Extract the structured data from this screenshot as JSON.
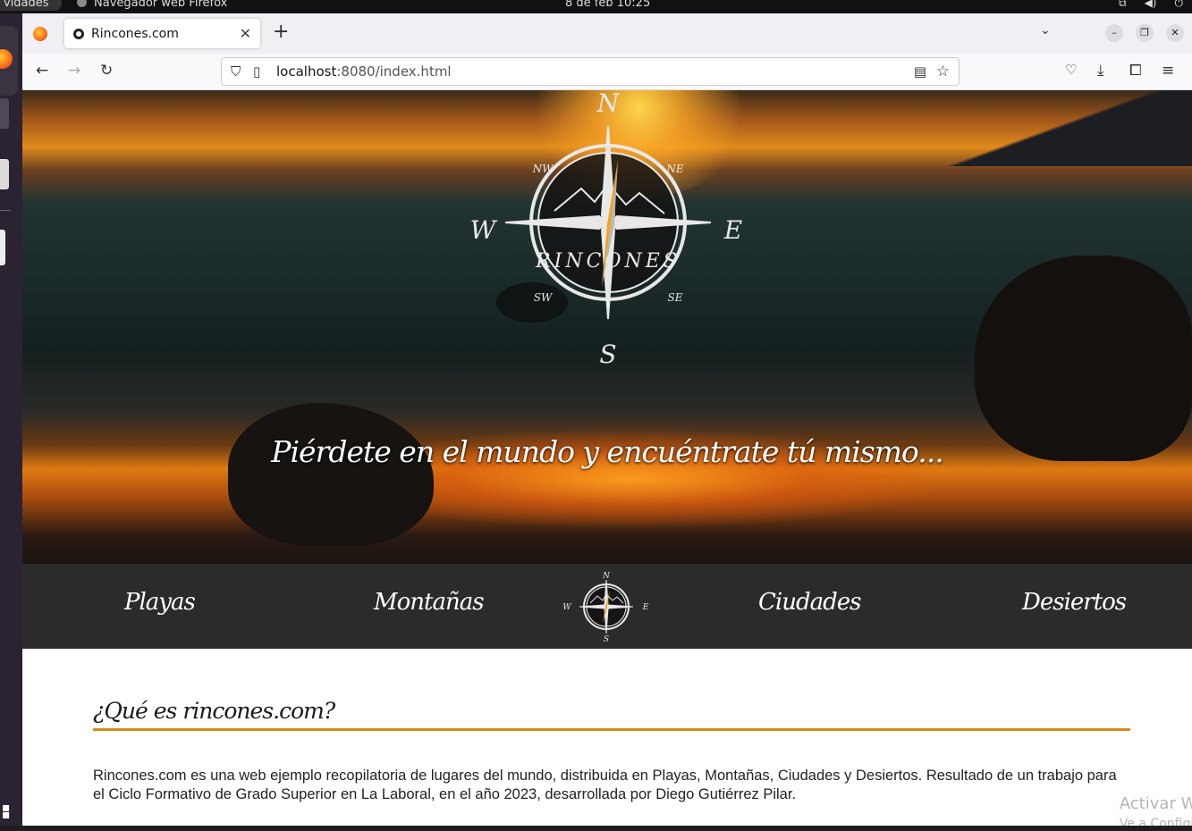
{
  "os": {
    "activities_label": "vidades",
    "app_label": "Navegador web Firefox",
    "clock": "8 de feb  10:25"
  },
  "browser": {
    "tab_title": "Rincones.com",
    "url_host": "localhost",
    "url_rest": ":8080/index.html"
  },
  "hero": {
    "slogan": "Piérdete en el mundo y encuéntrate tú mismo...",
    "compass": {
      "north": "N",
      "south": "S",
      "east": "E",
      "west": "W",
      "northwest": "NW",
      "northeast": "NE",
      "southwest": "SW",
      "southeast": "SE",
      "brand": "RINCONES"
    }
  },
  "menu": {
    "items": [
      "Playas",
      "Montañas",
      "Ciudades",
      "Desiertos"
    ],
    "logo_letters": {
      "n": "N",
      "s": "S",
      "e": "E",
      "w": "W"
    }
  },
  "about": {
    "title": "¿Qué es rincones.com?",
    "text": "Rincones.com es una web ejemplo recopilatoria de lugares del mundo, distribuida en Playas, Montañas, Ciudades y Desiertos. Resultado de un trabajo para el Ciclo Formativo de Grado Superior en La Laboral, en el año 2023, desarrollada por Diego Gutiérrez Pilar."
  },
  "watermark": {
    "line1": "Activar Wi",
    "line2": "Ve a Configu"
  },
  "colors": {
    "accent": "#d98a1e",
    "menu_bg": "#2b2b2b"
  }
}
